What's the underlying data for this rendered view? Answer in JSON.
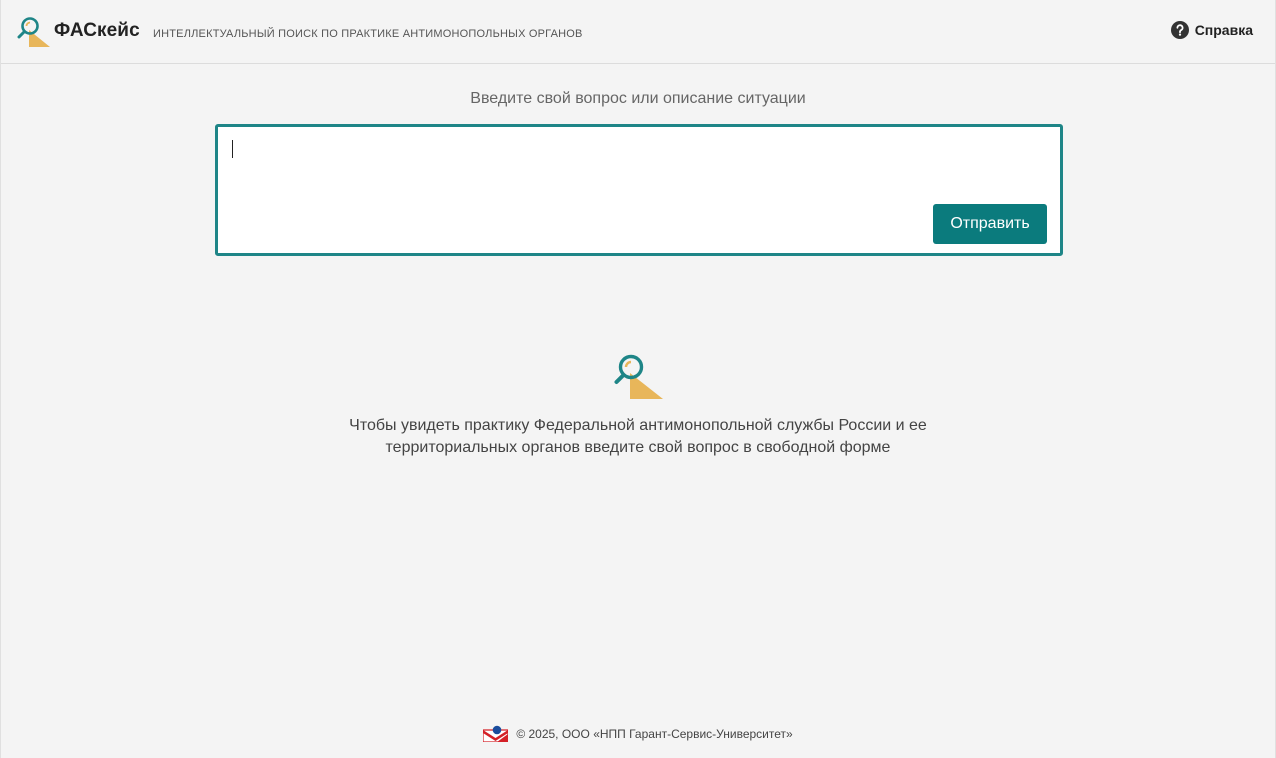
{
  "header": {
    "app_name": "ФАСкейс",
    "subtitle": "ИНТЕЛЛЕКТУАЛЬНЫЙ ПОИСК ПО ПРАКТИКЕ АНТИМОНОПОЛЬНЫХ ОРГАНОВ",
    "help_label": "Справка",
    "logo_icon": "magnifier-triangle-icon",
    "help_icon": "question-circle-icon"
  },
  "search": {
    "prompt_label": "Введите свой вопрос или описание ситуации",
    "value": "",
    "submit_label": "Отправить"
  },
  "empty_state": {
    "icon": "magnifier-triangle-icon",
    "line1": "Чтобы увидеть практику Федеральной антимонопольной службы России и ее",
    "line2": "территориальных органов введите свой вопрос в свободной форме"
  },
  "footer": {
    "logo_icon": "garant-logo-icon",
    "copyright": "© 2025, ООО «НПП Гарант-Сервис-Университет»"
  },
  "colors": {
    "accent": "#0b7b7d",
    "border_accent": "#1e8587",
    "icon_yellow": "#e8b65a",
    "background": "#f4f4f4"
  }
}
